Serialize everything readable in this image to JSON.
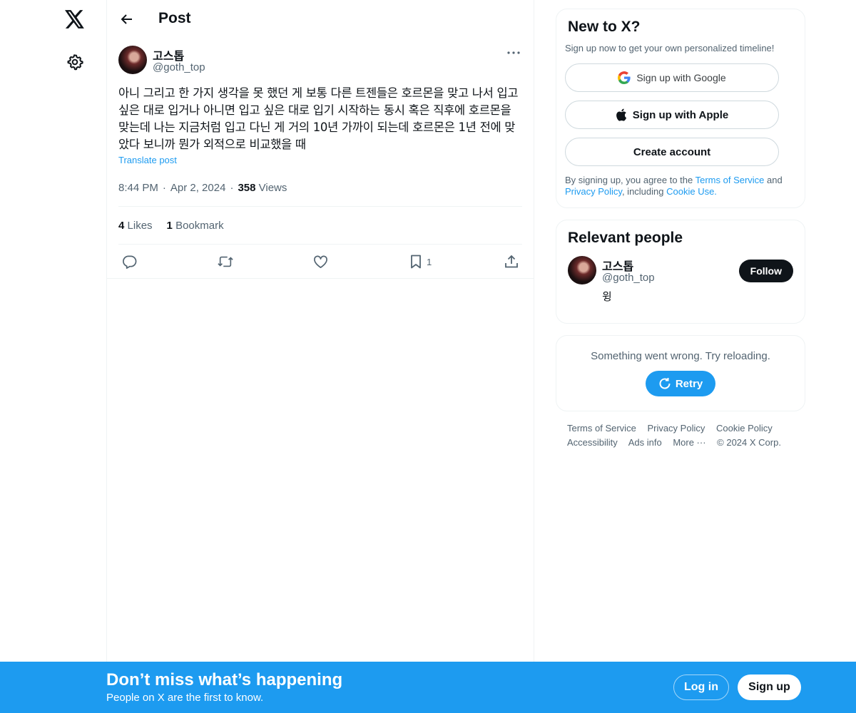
{
  "header": {
    "title": "Post"
  },
  "post": {
    "author_name": "고스톱",
    "author_handle": "@goth_top",
    "text": "아니 그리고 한 가지 생각을 못 했던 게 보통 다른 트젠들은 호르몬을 맞고 나서 입고 싶은 대로 입거나 아니면 입고 싶은 대로 입기 시작하는 동시 혹은 직후에 호르몬을 맞는데 나는 지금처럼 입고 다닌 게 거의 10년 가까이 되는데 호르몬은 1년 전에 맞았다 보니까 뭔가 외적으로 비교했을 때",
    "translate_label": "Translate post",
    "time": "8:44 PM",
    "date": "Apr 2, 2024",
    "views_count": "358",
    "views_label": "Views",
    "likes_count": "4",
    "likes_label": "Likes",
    "bookmarks_count": "1",
    "bookmarks_label": "Bookmark",
    "bookmark_action_count": "1"
  },
  "sidebar": {
    "signup_card": {
      "title": "New to X?",
      "subtitle": "Sign up now to get your own personalized timeline!",
      "google_label": "Sign up with Google",
      "apple_label": "Sign up with Apple",
      "create_label": "Create account",
      "legal_prefix": "By signing up, you agree to the ",
      "terms_link": "Terms of Service",
      "legal_and": " and",
      "privacy_link": "Privacy Policy",
      "legal_including": ", including ",
      "cookie_link": "Cookie Use."
    },
    "relevant": {
      "title": "Relevant people",
      "name": "고스톱",
      "handle": "@goth_top",
      "bio": "윙",
      "follow_label": "Follow"
    },
    "error": {
      "message": "Something went wrong. Try reloading.",
      "retry_label": "Retry"
    },
    "footer": {
      "terms": "Terms of Service",
      "privacy": "Privacy Policy",
      "cookie": "Cookie Policy",
      "accessibility": "Accessibility",
      "ads": "Ads info",
      "more": "More ···",
      "copyright": "© 2024 X Corp."
    }
  },
  "banner": {
    "title": "Don’t miss what’s happening",
    "subtitle": "People on X are the first to know.",
    "login_label": "Log in",
    "signup_label": "Sign up"
  },
  "colors": {
    "accent": "#1d9bf0",
    "text": "#0f1419",
    "muted": "#536471"
  },
  "icons": [
    "x-logo-icon",
    "gear-icon",
    "back-arrow-icon",
    "more-icon",
    "reply-icon",
    "repost-icon",
    "like-icon",
    "bookmark-icon",
    "share-icon",
    "google-icon",
    "apple-icon",
    "retry-icon"
  ]
}
